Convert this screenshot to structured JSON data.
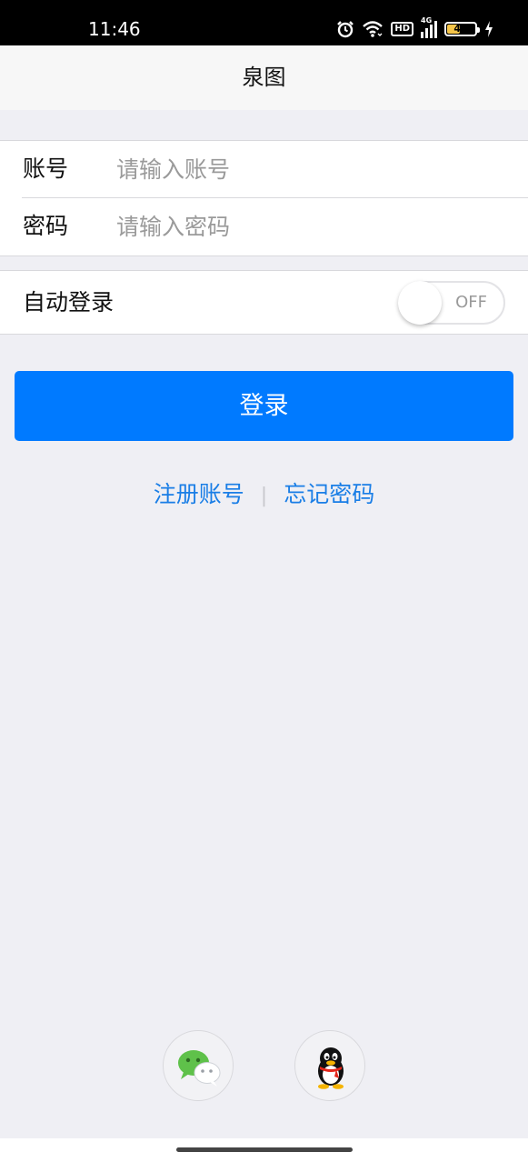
{
  "status_bar": {
    "time": "11:46",
    "network": "4G",
    "hd": "HD",
    "battery_level": "43",
    "icons": [
      "alarm-icon",
      "wifi-icon",
      "hd-icon",
      "signal-icon",
      "battery-icon",
      "charging-icon"
    ]
  },
  "nav": {
    "title": "泉图"
  },
  "login_form": {
    "account_label": "账号",
    "account_placeholder": "请输入账号",
    "account_value": "",
    "password_label": "密码",
    "password_placeholder": "请输入密码",
    "password_value": ""
  },
  "auto_login": {
    "label": "自动登录",
    "toggle_state": "OFF"
  },
  "login_button": {
    "label": "登录"
  },
  "links": {
    "register": "注册账号",
    "separator": "|",
    "forgot": "忘记密码"
  },
  "social_login": [
    {
      "name": "wechat",
      "icon": "wechat-icon"
    },
    {
      "name": "qq",
      "icon": "qq-icon"
    }
  ],
  "colors": {
    "accent": "#007aff",
    "link": "#1a7ee6",
    "background": "#efeff4"
  }
}
